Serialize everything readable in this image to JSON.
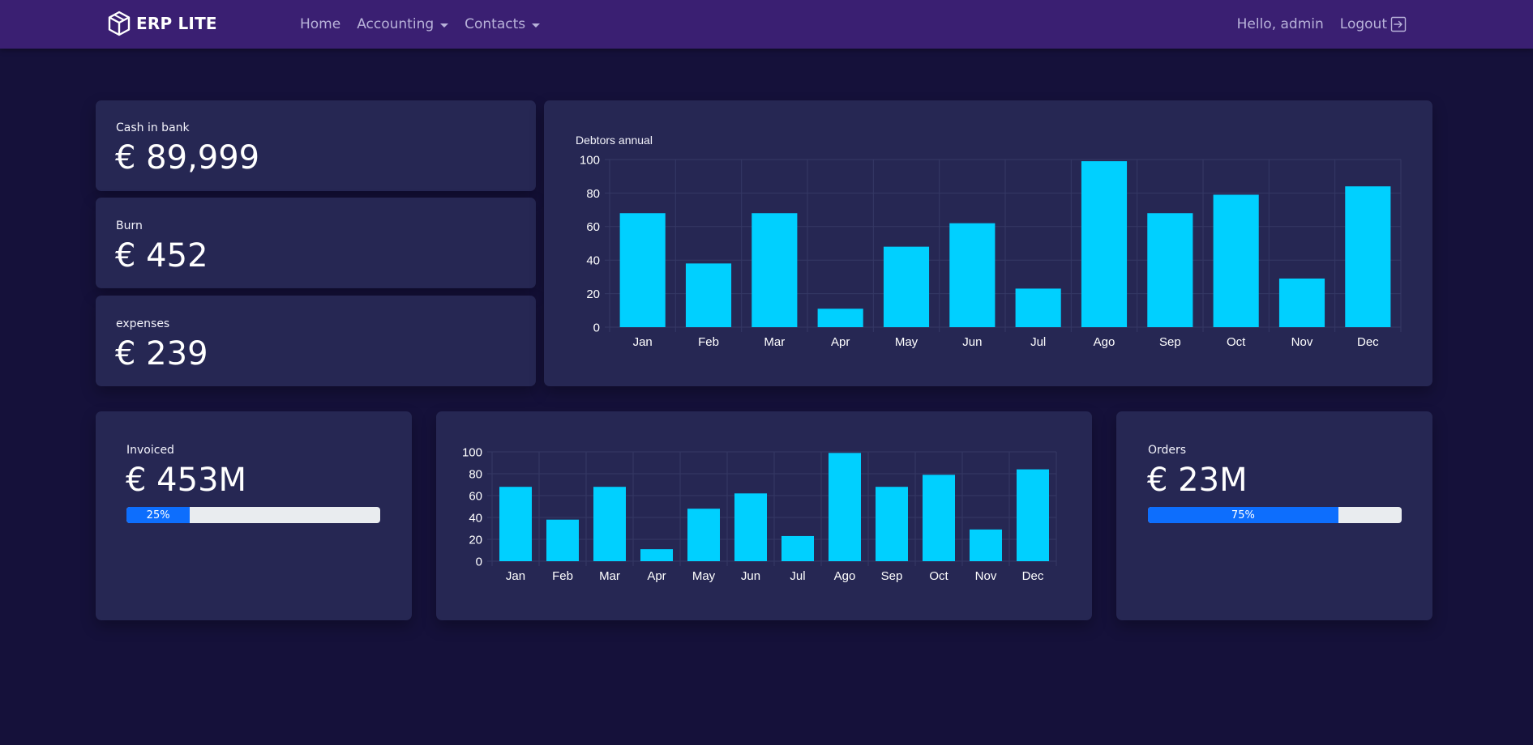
{
  "navbar": {
    "brand": "ERP LITE",
    "links": [
      {
        "label": "Home",
        "dropdown": false
      },
      {
        "label": "Accounting",
        "dropdown": true
      },
      {
        "label": "Contacts",
        "dropdown": true
      }
    ],
    "greeting": "Hello, admin",
    "logout_label": "Logout"
  },
  "stats": {
    "cash": {
      "label": "Cash in bank",
      "value": "€ 89,999"
    },
    "burn": {
      "label": "Burn",
      "value": "€ 452"
    },
    "expenses": {
      "label": "expenses",
      "value": "€ 239"
    },
    "invoiced": {
      "label": "Invoiced",
      "value": "€ 453M",
      "progress": 25,
      "progress_label": "25%"
    },
    "orders": {
      "label": "Orders",
      "value": "€ 23M",
      "progress": 75,
      "progress_label": "75%"
    }
  },
  "colors": {
    "background": "#15113a",
    "navbar": "#3a1f72",
    "card": "#262753",
    "bar": "#00d0ff",
    "progress": "#0d6efd"
  },
  "chart_data": [
    {
      "type": "bar",
      "title": "Debtors annual",
      "categories": [
        "Jan",
        "Feb",
        "Mar",
        "Apr",
        "May",
        "Jun",
        "Jul",
        "Ago",
        "Sep",
        "Oct",
        "Nov",
        "Dec"
      ],
      "values": [
        68,
        38,
        68,
        11,
        48,
        62,
        23,
        99,
        68,
        79,
        29,
        84
      ],
      "ylim": [
        0,
        100
      ],
      "yticks": [
        0,
        20,
        40,
        60,
        80,
        100
      ],
      "grid": true,
      "color": "#00d0ff"
    },
    {
      "type": "bar",
      "title": "",
      "categories": [
        "Jan",
        "Feb",
        "Mar",
        "Apr",
        "May",
        "Jun",
        "Jul",
        "Ago",
        "Sep",
        "Oct",
        "Nov",
        "Dec"
      ],
      "values": [
        68,
        38,
        68,
        11,
        48,
        62,
        23,
        99,
        68,
        79,
        29,
        84
      ],
      "ylim": [
        0,
        100
      ],
      "yticks": [
        0,
        20,
        40,
        60,
        80,
        100
      ],
      "grid": true,
      "color": "#00d0ff"
    }
  ]
}
